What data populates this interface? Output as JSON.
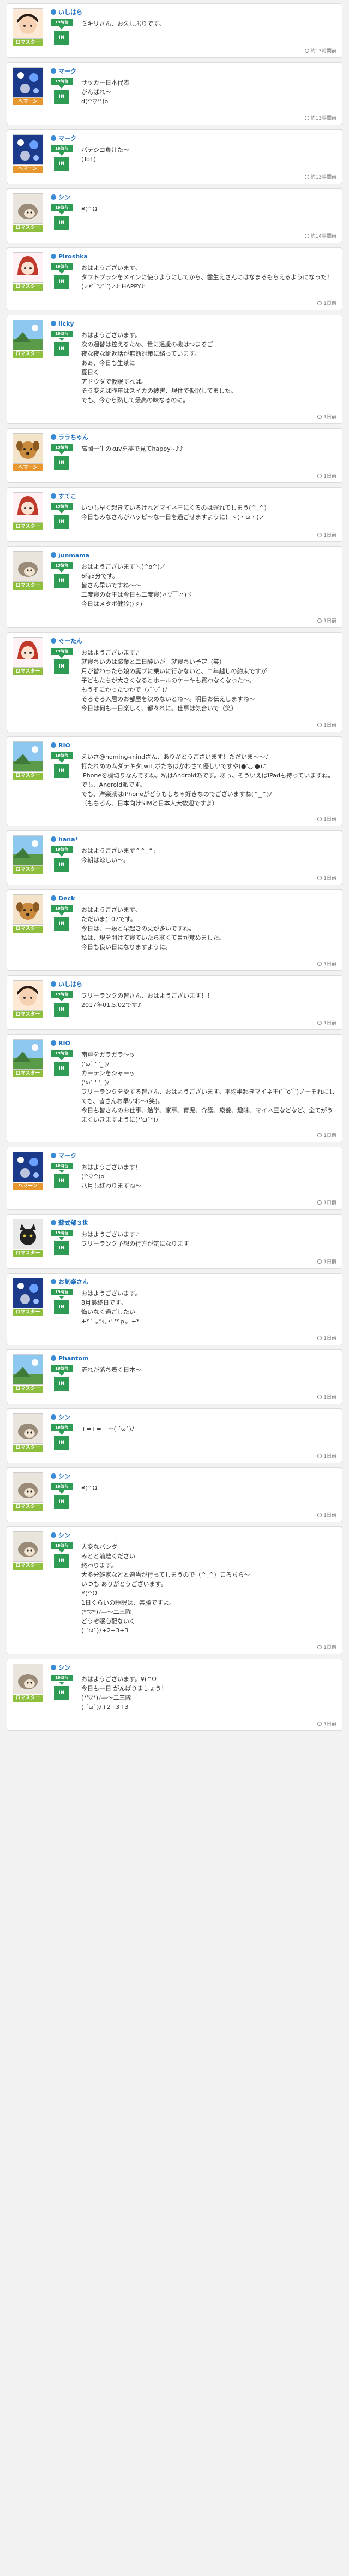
{
  "badge": {
    "top": "19時台",
    "bottom": "IN"
  },
  "colors": {
    "master": "#8fbf3f",
    "hemma": "#e8962e",
    "name": "#1d6fc1",
    "badge": "#2e9c54"
  },
  "posts": [
    {
      "name": "いしはら",
      "rank": "ロマスター",
      "rank_color": "#8fbf3f",
      "avatar": "hair-black",
      "message": "ミキリさん、お久しぶりです。",
      "time": "約13時間前"
    },
    {
      "name": "マーク",
      "rank": "ヘマーン",
      "rank_color": "#e8962e",
      "avatar": "dots",
      "message": "サッカー日本代表\nがんばれ〜\nd(^▽^)o",
      "time": "約13時間前"
    },
    {
      "name": "マーク",
      "rank": "ヘマーン",
      "rank_color": "#e8962e",
      "avatar": "dots",
      "message": "バテシコ負けた〜\n(ToT)",
      "time": "約13時間前"
    },
    {
      "name": "シン",
      "rank": "ロマスター",
      "rank_color": "#8fbf3f",
      "avatar": "hedgehog",
      "message": "¥(^Ω",
      "time": "約14時間前"
    },
    {
      "name": "Piroshka",
      "rank": "ロマスター",
      "rank_color": "#8fbf3f",
      "avatar": "character",
      "message": "おはようございます。\nタフトプラシをメインに使うようにしてから、歯生えさんにはなまるもらえるようになった！\n(≠ε⌒▽⌒)≠♪ HAPPY♪",
      "time": "1日前"
    },
    {
      "name": "licky",
      "rank": "ロマスター",
      "rank_color": "#8fbf3f",
      "avatar": "landscape",
      "message": "おはようございます。\n次の週替は控えるため、世に遠慮の機はつまるご\n夜な夜な誕返話が無効対策に絡っています。\nあぁ、今日も生茶に\n憂日く\nアドウダで仮眠すれば。\nそう変えば昨年はスイカの被害、現住で仮眠してました。\nでも、今から熟して最高の味なるのに。",
      "time": "1日前"
    },
    {
      "name": "ララちゃん",
      "rank": "ヘマーン",
      "rank_color": "#e8962e",
      "avatar": "dog",
      "message": "高岡一生のkuvを夢で見てhappy~♪♪",
      "time": "1日前"
    },
    {
      "name": "すてこ",
      "rank": "ロマスター",
      "rank_color": "#8fbf3f",
      "avatar": "character",
      "message": "いつも早く起きているけれどマイネ王にくるのは遅れてしまう(^_^)\n今日もみなさんがハッピ〜な一日を過ごせますように！ヽ(・ω・)ノ",
      "time": "1日前"
    },
    {
      "name": "junmama",
      "rank": "ロマスター",
      "rank_color": "#8fbf3f",
      "avatar": "hedgehog",
      "message": "おはようございます＼(^o^)／\n6時5分です。\n皆さん早いですね〜〜\n二度寝の女王は今日も二度寝(〃▽￣〃)ゞ\n今日はメタボ健診()ゞ)",
      "time": "1日前"
    },
    {
      "name": "ぐーたん",
      "rank": "ロマスター",
      "rank_color": "#8fbf3f",
      "avatar": "character",
      "message": "おはようございます♪\n就寝ちいのは職業と二日酔いが　就寝ちい予定（笑）\n月が替わったら娘の誕プに乗いに行かないと、二年越しの約束ですが\n子どもたちが大きくなるとホールのケーキも買わなくなった〜。\nもうそにかったつかで（ﾉﾟ▽ﾟ)ﾉ\nそろそろ入居のお部屋を決めないとね〜。明日お伝えしますね〜\n今日は何も一日楽しく、都々れに。仕事は気合いで（笑）",
      "time": "1日前"
    },
    {
      "name": "RIO",
      "rank": "ロマスター",
      "rank_color": "#8fbf3f",
      "avatar": "landscape",
      "message": "えいさ@homing-mindさん、ありがとうございます！ただいま〜〜♪\n打たれめのムダテキタ[wit]ボたちはかわさて優しいですや(●'◡'●)♪\niPhoneを機切りなんですね。私はAndroid派です。あっ、そういえばiPadも持っていますね。でも、Android派です。\nでも、洋楽派はiPhoneがどうもしちゃ好きなのでございますね(^_^)ﾉ\n（もちろん、日本向けSIMと日本人大歓迎ですよ）",
      "time": "1日前"
    },
    {
      "name": "hana*",
      "rank": "ロマスター",
      "rank_color": "#8fbf3f",
      "avatar": "landscape",
      "message": "おはようございます^^_^;\n今朝は涼しい〜。",
      "time": "1日前"
    },
    {
      "name": "Deck",
      "rank": "ロマスター",
      "rank_color": "#8fbf3f",
      "avatar": "dog",
      "message": "おはようございます。\nただいま：07です。\n今日は、一段と早起きの丈が多いですね。\n私は、現を開けて寝ていたら寒くて目が覚めました。\n今日も良い日になりますように。",
      "time": "1日前"
    },
    {
      "name": "いしはら",
      "rank": "ロマスター",
      "rank_color": "#8fbf3f",
      "avatar": "hair-black",
      "message": "フリーランクの皆さん、おはようございます！！\n2017年01.5.02です♪",
      "time": "1日前"
    },
    {
      "name": "RIO",
      "rank": "ロマスター",
      "rank_color": "#8fbf3f",
      "avatar": "landscape",
      "message": "南戸をガラガラ〜ッ\n('ω`'' '_')/\nカーテンをシャーッ\n('ω`'' '_')/\nフリーランクを愛する皆さん、おはようございます。平均半起きマイネ王(⌒o⌒)ノーそれにしても、皆さんお早いわ〜(笑)。\n今日も皆さんのお仕事、勉学、家事、育児、介護、療養、趣味、マイネ王などなど、全てがうまくいきますように(*'ω`*)ﾉ",
      "time": "1日前"
    },
    {
      "name": "マーク",
      "rank": "ヘマーン",
      "rank_color": "#e8962e",
      "avatar": "dots",
      "message": "おはようございます！\n(^▽^)o\n八月も終わりますね〜",
      "time": "1日前"
    },
    {
      "name": "蘇式部３世",
      "rank": "ロマスター",
      "rank_color": "#8fbf3f",
      "avatar": "cat",
      "message": "おはようございます♪\nフリーランク予想の行方が気になります",
      "time": "1日前"
    },
    {
      "name": "お気楽さん",
      "rank": "ロマスター",
      "rank_color": "#8fbf3f",
      "avatar": "dots",
      "message": "おはようございます。\n8月最終日です。\n悔いなく過ごしたい\n+* ﾟ ｡*ｩ｡•' '*ｐ。+*",
      "time": "1日前"
    },
    {
      "name": "Phantom",
      "rank": "ロマスター",
      "rank_color": "#8fbf3f",
      "avatar": "landscape",
      "message": "流れが落ち着く日本〜",
      "time": "1日前"
    },
    {
      "name": "シン",
      "rank": "ロマスター",
      "rank_color": "#8fbf3f",
      "avatar": "hedgehog",
      "message": "+=+=+ ☆( ´ω`)ﾉ",
      "time": "1日前"
    },
    {
      "name": "シン",
      "rank": "ロマスター",
      "rank_color": "#8fbf3f",
      "avatar": "hedgehog",
      "message": "¥(^Ω",
      "time": "1日前"
    },
    {
      "name": "シン",
      "rank": "ロマスター",
      "rank_color": "#8fbf3f",
      "avatar": "hedgehog",
      "message": "大変なバンダ\nみとと前離ください\n終わります。\n大多分雑家などと適当が行ってしまうので（^_^）ころちら〜\nいつも ありがとうございます。\n¥(^Ω\n1日くらいの睡眠は、楽勝ですよ。\n(*'▽*)ﾉ—〜二三隊\nどうぞ眠心配ないく\n( ´ω`)ﾉ+2+3+3",
      "time": "1日前"
    },
    {
      "name": "シン",
      "rank": "ロマスター",
      "rank_color": "#8fbf3f",
      "avatar": "hedgehog",
      "message": "おはようございます。¥(^Ω\n今日も一日 がんばりましょう！\n(*'▽*)ﾉ—〜二三隊\n( ´ω`)ﾉ+2+3+3",
      "time": "1日前"
    }
  ]
}
